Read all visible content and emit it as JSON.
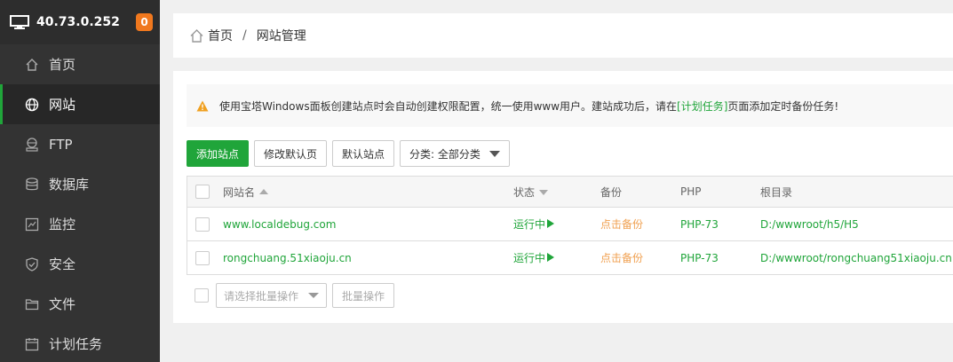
{
  "sidebar": {
    "server_ip": "40.73.0.252",
    "badge": "0",
    "items": [
      {
        "label": "首页",
        "icon": "home-icon"
      },
      {
        "label": "网站",
        "icon": "globe-icon",
        "active": true
      },
      {
        "label": "FTP",
        "icon": "ftp-icon"
      },
      {
        "label": "数据库",
        "icon": "database-icon"
      },
      {
        "label": "监控",
        "icon": "monitor-chart-icon"
      },
      {
        "label": "安全",
        "icon": "shield-icon"
      },
      {
        "label": "文件",
        "icon": "folder-icon"
      },
      {
        "label": "计划任务",
        "icon": "calendar-icon"
      }
    ]
  },
  "breadcrumb": {
    "home": "首页",
    "separator": "/",
    "current": "网站管理"
  },
  "notice": {
    "text_before": "使用宝塔Windows面板创建站点时会自动创建权限配置，统一使用www用户。建站成功后，请在",
    "link": "[计划任务]",
    "text_after": "页面添加定时备份任务!"
  },
  "toolbar": {
    "add_site": "添加站点",
    "modify_default_page": "修改默认页",
    "default_site": "默认站点",
    "category": "分类: 全部分类"
  },
  "table": {
    "headers": {
      "name": "网站名",
      "status": "状态",
      "backup": "备份",
      "php": "PHP",
      "root": "根目录"
    },
    "rows": [
      {
        "name": "www.localdebug.com",
        "status": "运行中",
        "backup": "点击备份",
        "php": "PHP-73",
        "root": "D:/wwwroot/h5/H5"
      },
      {
        "name": "rongchuang.51xiaoju.cn",
        "status": "运行中",
        "backup": "点击备份",
        "php": "PHP-73",
        "root": "D:/wwwroot/rongchuang51xiaoju.cn"
      }
    ]
  },
  "batch": {
    "select_placeholder": "请选择批量操作",
    "button": "批量操作"
  },
  "colors": {
    "accent": "#20a53a",
    "badge": "#f0781e",
    "backup_link": "#f0a050",
    "sidebar_bg": "#333333"
  }
}
